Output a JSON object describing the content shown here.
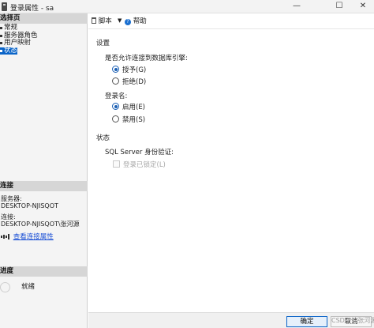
{
  "window": {
    "title": "登录属性 - sa",
    "minimize": "—",
    "maximize": "☐",
    "close": "✕"
  },
  "left": {
    "select_page_header": "选择页",
    "nav_items": [
      {
        "label": "常规"
      },
      {
        "label": "服务器角色"
      },
      {
        "label": "用户映射"
      },
      {
        "label": "状态"
      }
    ],
    "connection_header": "连接",
    "server_label": "服务器:",
    "server_value": "DESKTOP-NJISQOT",
    "connection_label": "连接:",
    "connection_value": "DESKTOP-NJISQOT\\张河源",
    "view_connection_link": "查看连接属性",
    "progress_header": "进度",
    "progress_status": "就绪"
  },
  "toolbar": {
    "script_label": "脚本",
    "script_dropdown": "▼",
    "help_label": "帮助"
  },
  "content": {
    "settings_title": "设置",
    "permission_question": "是否允许连接到数据库引擎:",
    "grant_label": "授予(G)",
    "deny_label": "拒绝(D)",
    "permission_selected": "grant",
    "login_title": "登录名:",
    "enabled_label": "启用(E)",
    "disabled_label": "禁用(S)",
    "login_selected": "enabled",
    "status_title": "状态",
    "auth_label": "SQL Server 身份验证:",
    "locked_label": "登录已锁定(L)",
    "locked_checked": false
  },
  "bottom": {
    "ok_label": "确定",
    "cancel_label": "取消"
  },
  "watermark": "CSDN @张河源",
  "colors": {
    "accent": "#0a64c8",
    "link": "#1a4fd6",
    "section_header": "#d6d6d6"
  }
}
